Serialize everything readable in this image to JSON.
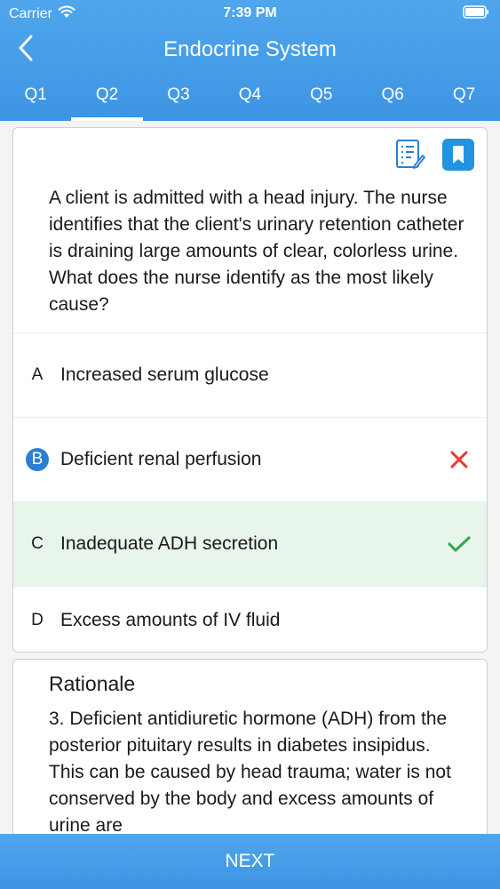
{
  "status_bar": {
    "carrier": "Carrier",
    "time": "7:39 PM"
  },
  "nav": {
    "title": "Endocrine System"
  },
  "tabs": [
    {
      "label": "Q1"
    },
    {
      "label": "Q2"
    },
    {
      "label": "Q3"
    },
    {
      "label": "Q4"
    },
    {
      "label": "Q5"
    },
    {
      "label": "Q6"
    },
    {
      "label": "Q7"
    }
  ],
  "active_tab": "Q2",
  "question": {
    "text": "A client is admitted with a head injury. The nurse identifies that the client's urinary retention catheter is draining large amounts of clear, colorless urine. What does the nurse identify as the most likely cause?"
  },
  "options": [
    {
      "letter": "A",
      "text": "Increased serum glucose",
      "state": "none"
    },
    {
      "letter": "B",
      "text": "Deficient renal perfusion",
      "state": "wrong"
    },
    {
      "letter": "C",
      "text": "Inadequate ADH secretion",
      "state": "correct"
    },
    {
      "letter": "D",
      "text": "Excess amounts of IV fluid",
      "state": "none"
    }
  ],
  "rationale": {
    "title": "Rationale",
    "text": "3. Deficient antidiuretic hormone (ADH) from the posterior pituitary results in diabetes insipidus. This can be caused by head trauma; water is not conserved by the body and excess amounts of urine are"
  },
  "footer": {
    "next_label": "NEXT"
  },
  "colors": {
    "accent": "#3d95e3",
    "selected": "#2c7fd1",
    "wrong": "#e53935",
    "correct": "#3aa655",
    "correct_bg": "#e8f5ea"
  },
  "icons": {
    "back": "chevron-left-icon",
    "wifi": "wifi-icon",
    "battery": "battery-icon",
    "notes": "notes-icon",
    "bookmark": "bookmark-icon",
    "wrong": "x-mark-icon",
    "correct": "check-mark-icon"
  }
}
